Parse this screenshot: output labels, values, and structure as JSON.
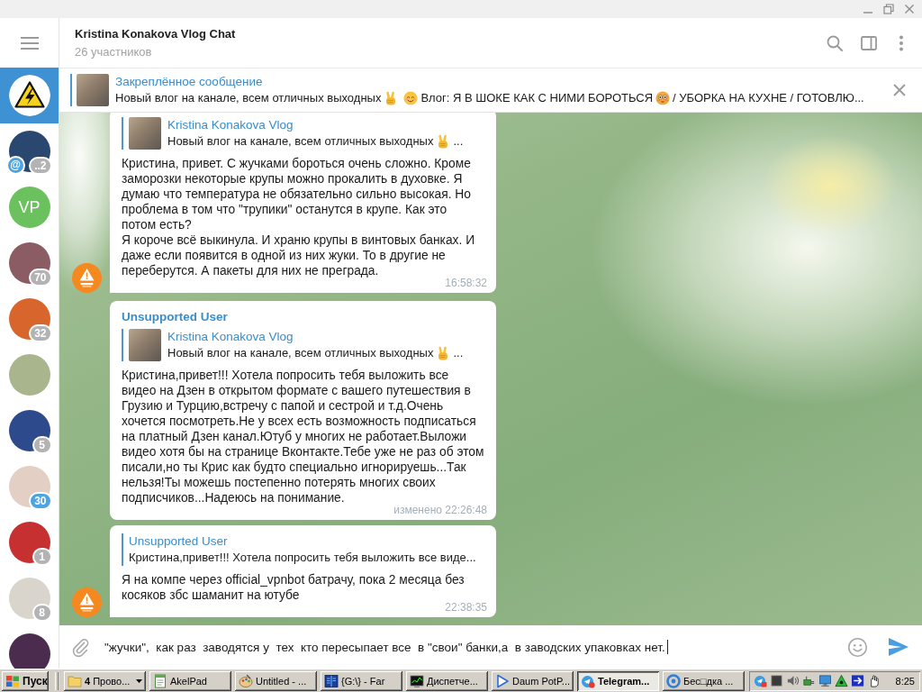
{
  "sidebar": {
    "items": [
      {
        "kind": "warning",
        "selected": true
      },
      {
        "kind": "photo",
        "selected": false,
        "mention": "@",
        "badge": {
          "text": "..2",
          "muted": true
        }
      },
      {
        "kind": "initials",
        "initials": "VP",
        "color": "#6cc15f",
        "selected": false
      },
      {
        "kind": "photo",
        "selected": false,
        "badge": {
          "text": "70",
          "muted": true
        }
      },
      {
        "kind": "photo",
        "selected": false,
        "badge": {
          "text": "32",
          "muted": true
        }
      },
      {
        "kind": "photo",
        "selected": false
      },
      {
        "kind": "photo",
        "selected": false,
        "badge": {
          "text": "5",
          "muted": true
        }
      },
      {
        "kind": "photo",
        "selected": false,
        "badge": {
          "text": "30",
          "muted": false
        }
      },
      {
        "kind": "photo",
        "selected": false,
        "badge": {
          "text": "1",
          "muted": true
        }
      },
      {
        "kind": "photo",
        "selected": false,
        "badge": {
          "text": "8",
          "muted": true
        }
      },
      {
        "kind": "photo",
        "selected": false
      }
    ]
  },
  "header": {
    "title": "Kristina Konakova Vlog Chat",
    "subtitle": "26 участников"
  },
  "pinned": {
    "label": "Закреплённое сообщение",
    "parts": [
      {
        "kind": "text",
        "text": "Новый влог на канале, всем отличных выходных"
      },
      {
        "kind": "victory"
      },
      {
        "kind": "smile"
      },
      {
        "kind": "text",
        "text": "Влог: Я В ШОКЕ КАК С НИМИ БОРОТЬСЯ"
      },
      {
        "kind": "flushed"
      },
      {
        "kind": "text",
        "text": "/ УБОРКА НА КУХНЕ / ГОТОВЛЮ..."
      }
    ]
  },
  "messages": [
    {
      "show_avatar": true,
      "reply": {
        "title": "Kristina Konakova Vlog",
        "thumbnail": true,
        "parts": [
          {
            "kind": "text",
            "text": "Новый влог на канале, всем отличных выходных"
          },
          {
            "kind": "victory"
          },
          {
            "kind": "text",
            "text": "..."
          }
        ]
      },
      "text": "Кристина, привет. С жучками бороться очень сложно. Кроме заморозки некоторые крупы можно прокалить в духовке. Я думаю что температура не обязательно сильно высокая. Но проблема в том что \"трупики\" останутся в крупе. Как это потом есть?\nЯ короче всё выкинула. И храню крупы в винтовых банках. И даже если появится в одной из них жуки. То в другие не переберутся. А пакеты для них не преграда.",
      "time": "16:58:32"
    },
    {
      "show_avatar": false,
      "sender": "Unsupported User",
      "reply": {
        "title": "Kristina Konakova Vlog",
        "thumbnail": true,
        "parts": [
          {
            "kind": "text",
            "text": "Новый влог на канале, всем отличных выходных"
          },
          {
            "kind": "victory"
          },
          {
            "kind": "text",
            "text": "..."
          }
        ]
      },
      "text": "Кристина,привет!!! Хотела попросить тебя выложить все видео на Дзен в открытом формате с вашего путешествия в Грузию и Турцию,встречу с папой и сестрой и т.д.Очень хочется посмотреть.Не у всех есть возможность подписаться на платный Дзен канал.Ютуб у многих не работает.Выложи видео хотя бы на странице Вконтакте.Тебе уже не раз об этом писали,но ты Крис как будто специально игнорируешь...Так нельзя!Ты можешь постепенно потерять многих своих подписчиков...Надеюсь на понимание.",
      "time": "изменено 22:26:48"
    },
    {
      "show_avatar": true,
      "reply": {
        "title": "Unsupported User",
        "thumbnail": false,
        "parts": [
          {
            "kind": "text",
            "text": "Кристина,привет!!! Хотела попросить тебя выложить все виде..."
          }
        ]
      },
      "text": "Я на компе через official_vpnbot батрачу, пока 2 месяца без косяков збс шаманит на ютубе",
      "time": "22:38:35"
    }
  ],
  "composer": {
    "value": "\"жучки\",  как раз  заводятся у  тех  кто пересыпает все  в \"свои\" банки,а  в заводских упаковках нет."
  },
  "taskbar": {
    "start": "Пуск",
    "buttons": [
      {
        "kind": "folder",
        "label": "**4** Прово...",
        "grouped": true,
        "selected": false
      },
      {
        "kind": "notepad",
        "label": "AkelPad",
        "grouped": false,
        "selected": false
      },
      {
        "kind": "paint",
        "label": "Untitled - ...",
        "grouped": false,
        "selected": false
      },
      {
        "kind": "far",
        "label": "{G:\\} - Far",
        "grouped": false,
        "selected": false
      },
      {
        "kind": "taskman",
        "label": "Диспетче...",
        "grouped": false,
        "selected": false
      },
      {
        "kind": "player",
        "label": "Daum PotP...",
        "grouped": false,
        "selected": false
      },
      {
        "kind": "telegram",
        "label": "Telegram...",
        "grouped": false,
        "selected": true
      },
      {
        "kind": "browser",
        "label": "Бес□дка ...",
        "grouped": false,
        "selected": false
      }
    ],
    "clock": "8:25"
  }
}
